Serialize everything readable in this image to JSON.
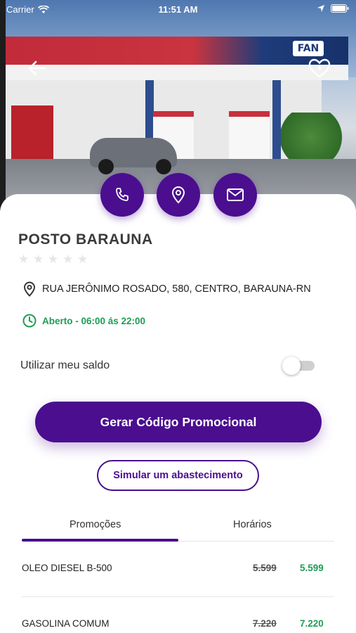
{
  "status_bar": {
    "carrier": "Carrier",
    "time": "11:51 AM"
  },
  "station": {
    "name": "POSTO BARAUNA",
    "rating": 0,
    "max_rating": 5,
    "address": "RUA JERÔNIMO ROSADO, 580, CENTRO, BARAUNA-RN",
    "hours": "Aberto - 06:00 ás 22:00",
    "sign_text": "FAN"
  },
  "actions": {
    "phone": "phone-icon",
    "location": "map-pin-icon",
    "email": "mail-icon"
  },
  "balance": {
    "label": "Utilizar meu saldo",
    "enabled": false
  },
  "buttons": {
    "generate": "Gerar Código Promocional",
    "simulate": "Simular um abastecimento"
  },
  "tabs": [
    {
      "label": "Promoções",
      "active": true
    },
    {
      "label": "Horários",
      "active": false
    }
  ],
  "promotions": [
    {
      "name": "OLEO DIESEL B-500",
      "old_price": "5.599",
      "new_price": "5.599"
    },
    {
      "name": "GASOLINA COMUM",
      "old_price": "7.220",
      "new_price": "7.220"
    }
  ],
  "colors": {
    "primary": "#4a0e8f",
    "open_green": "#1f9d55",
    "price_green": "#1f9d55"
  }
}
